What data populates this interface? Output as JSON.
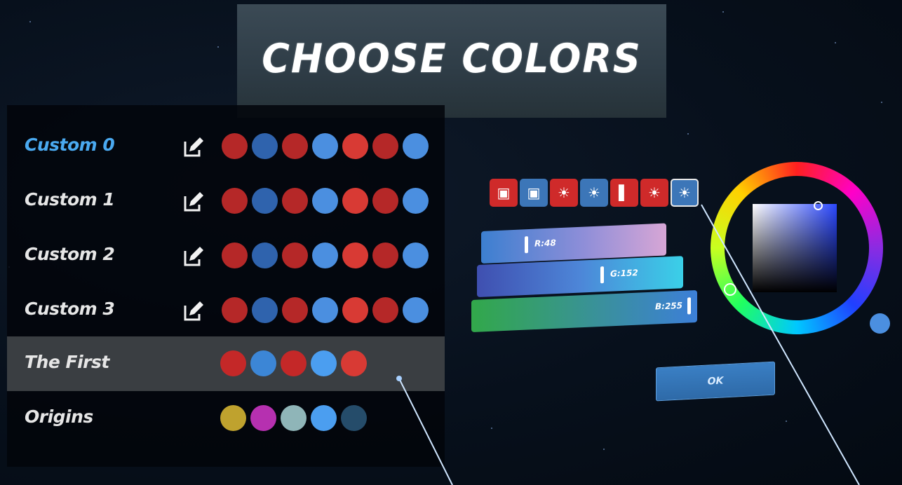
{
  "title": "CHOOSE COLORS",
  "schemes": [
    {
      "name": "Custom 0",
      "active": true,
      "editable": true,
      "colors": [
        "#b52828",
        "#2f63ad",
        "#b52828",
        "#4b8fe0",
        "#d83a34",
        "#b52828",
        "#4b8fe0"
      ]
    },
    {
      "name": "Custom 1",
      "active": false,
      "editable": true,
      "colors": [
        "#b52828",
        "#2f63ad",
        "#b52828",
        "#4b8fe0",
        "#d83a34",
        "#b52828",
        "#4b8fe0"
      ]
    },
    {
      "name": "Custom 2",
      "active": false,
      "editable": true,
      "colors": [
        "#b52828",
        "#2f63ad",
        "#b52828",
        "#4b8fe0",
        "#d83a34",
        "#b52828",
        "#4b8fe0"
      ]
    },
    {
      "name": "Custom 3",
      "active": false,
      "editable": true,
      "colors": [
        "#b52828",
        "#2f63ad",
        "#b52828",
        "#4b8fe0",
        "#d83a34",
        "#b52828",
        "#4b8fe0"
      ]
    },
    {
      "name": "The First",
      "active": false,
      "editable": false,
      "selected": true,
      "colors": [
        "#c42828",
        "#3c86d6",
        "#c42828",
        "#4b9ef0",
        "#d83a34"
      ]
    },
    {
      "name": "Origins",
      "active": false,
      "editable": false,
      "colors": [
        "#bfa22e",
        "#b630b0",
        "#8fb5b8",
        "#4b9ef0",
        "#254c6a"
      ]
    }
  ],
  "color_tabs": [
    {
      "icon": "saber-left-icon",
      "color": "red"
    },
    {
      "icon": "saber-right-icon",
      "color": "blue"
    },
    {
      "icon": "light-left-icon",
      "color": "red"
    },
    {
      "icon": "light-right-icon",
      "color": "blue"
    },
    {
      "icon": "wall-icon",
      "color": "red"
    },
    {
      "icon": "boost-left-icon",
      "color": "red"
    },
    {
      "icon": "boost-right-icon",
      "color": "blue",
      "selected": true
    }
  ],
  "sliders": {
    "r": {
      "label": "R:48",
      "value": 48
    },
    "g": {
      "label": "G:152",
      "value": 152
    },
    "b": {
      "label": "B:255",
      "value": 255
    }
  },
  "ok_label": "OK",
  "current_color": "#4b8fe0"
}
